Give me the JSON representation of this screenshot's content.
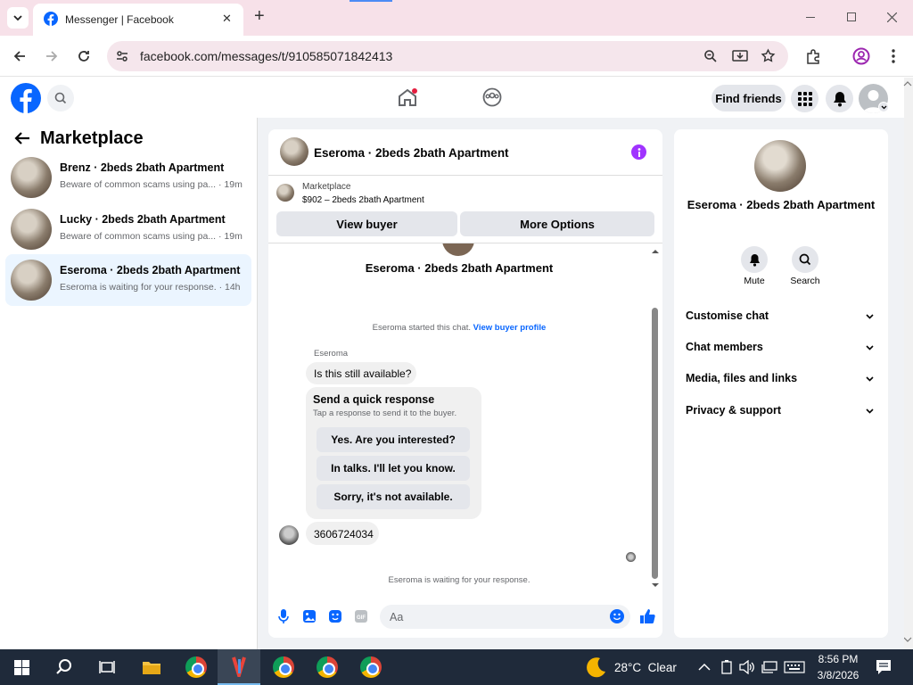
{
  "browser": {
    "tab_title": "Messenger | Facebook",
    "url": "facebook.com/messages/t/910585071842413",
    "new_tab": "+",
    "close_tab": "✕"
  },
  "fb_header": {
    "find_friends": "Find friends"
  },
  "sidebar": {
    "title": "Marketplace",
    "conversations": [
      {
        "name": "Brenz · 2beds 2bath Apartment",
        "snippet": "Beware of common scams using pa...",
        "time": "· 19m"
      },
      {
        "name": "Lucky · 2beds 2bath Apartment",
        "snippet": "Beware of common scams using pa...",
        "time": "· 19m"
      },
      {
        "name": "Eseroma · 2beds 2bath Apartment",
        "snippet": "Eseroma is waiting for your response.",
        "time": "· 14h"
      }
    ]
  },
  "chat": {
    "header_name": "Eseroma · 2beds 2bath Apartment",
    "marketplace_label": "Marketplace",
    "listing": "$902 – 2beds 2bath Apartment",
    "view_buyer": "View buyer",
    "more_options": "More Options",
    "profile_name": "Eseroma · 2beds 2bath Apartment",
    "started_text": "Eseroma started this chat.",
    "view_profile_link": "View buyer profile",
    "sender": "Eseroma",
    "message1": "Is this still available?",
    "quick_title": "Send a quick response",
    "quick_sub": "Tap a response to send it to the buyer.",
    "quick_options": [
      "Yes. Are you interested?",
      "In talks. I'll let you know.",
      "Sorry, it's not available."
    ],
    "message2": "3606724034",
    "waiting_text": "Eseroma is waiting for your response.",
    "input_placeholder": "Aa"
  },
  "info": {
    "name": "Eseroma · 2beds 2bath Apartment",
    "mute": "Mute",
    "search": "Search",
    "sections": [
      "Customise chat",
      "Chat members",
      "Media, files and links",
      "Privacy & support"
    ]
  },
  "taskbar": {
    "weather": "28°C  Clear",
    "time": "8:56 PM",
    "date": "3/8/2026",
    "chrome_badge": "F"
  },
  "colors": {
    "fb_blue": "#0866ff",
    "messenger_purple": "#a033ff",
    "selected_bg": "#ebf5ff"
  }
}
